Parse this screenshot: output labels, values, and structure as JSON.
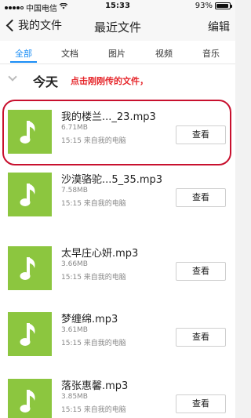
{
  "status_bar": {
    "carrier": "中国电信",
    "time": "15:33",
    "battery_percent": "93%",
    "battery_level": 0.93,
    "signal_bars": 4,
    "signal_bars_total": 5
  },
  "nav": {
    "back_label": "我的文件",
    "title": "最近文件",
    "edit_label": "编辑"
  },
  "tabs": [
    {
      "label": "全部"
    },
    {
      "label": "文档"
    },
    {
      "label": "图片"
    },
    {
      "label": "视频"
    },
    {
      "label": "音乐"
    }
  ],
  "active_tab": "全部",
  "section": {
    "title": "今天",
    "annotation": "点击刚刚传的文件，"
  },
  "files": [
    {
      "name": "我的楼兰..._23.mp3",
      "size": "6.71MB",
      "meta": "15:15 来自我的电脑",
      "action": "查看"
    },
    {
      "name": "沙漠骆驼...5_35.mp3",
      "size": "7.58MB",
      "meta": "15:15 来自我的电脑",
      "action": "查看"
    },
    {
      "name": "太早庄心妍.mp3",
      "size": "3.66MB",
      "meta": "15:15 来自我的电脑",
      "action": "查看"
    },
    {
      "name": "梦缠绵.mp3",
      "size": "3.61MB",
      "meta": "15:15 来自我的电脑",
      "action": "查看"
    },
    {
      "name": "落张惠馨.mp3",
      "size": "3.85MB",
      "meta": "15:15 来自我的电脑",
      "action": "查看"
    }
  ],
  "colors": {
    "accent": "#1a8df5",
    "annotation": "#e6262b",
    "highlight": "#c8102e",
    "file_icon": "#8cc63f"
  },
  "icons": {
    "back": "chevron-left-icon",
    "collapse": "chevron-down-icon",
    "file": "music-note-icon",
    "wifi": "wifi-icon",
    "battery": "battery-icon"
  }
}
